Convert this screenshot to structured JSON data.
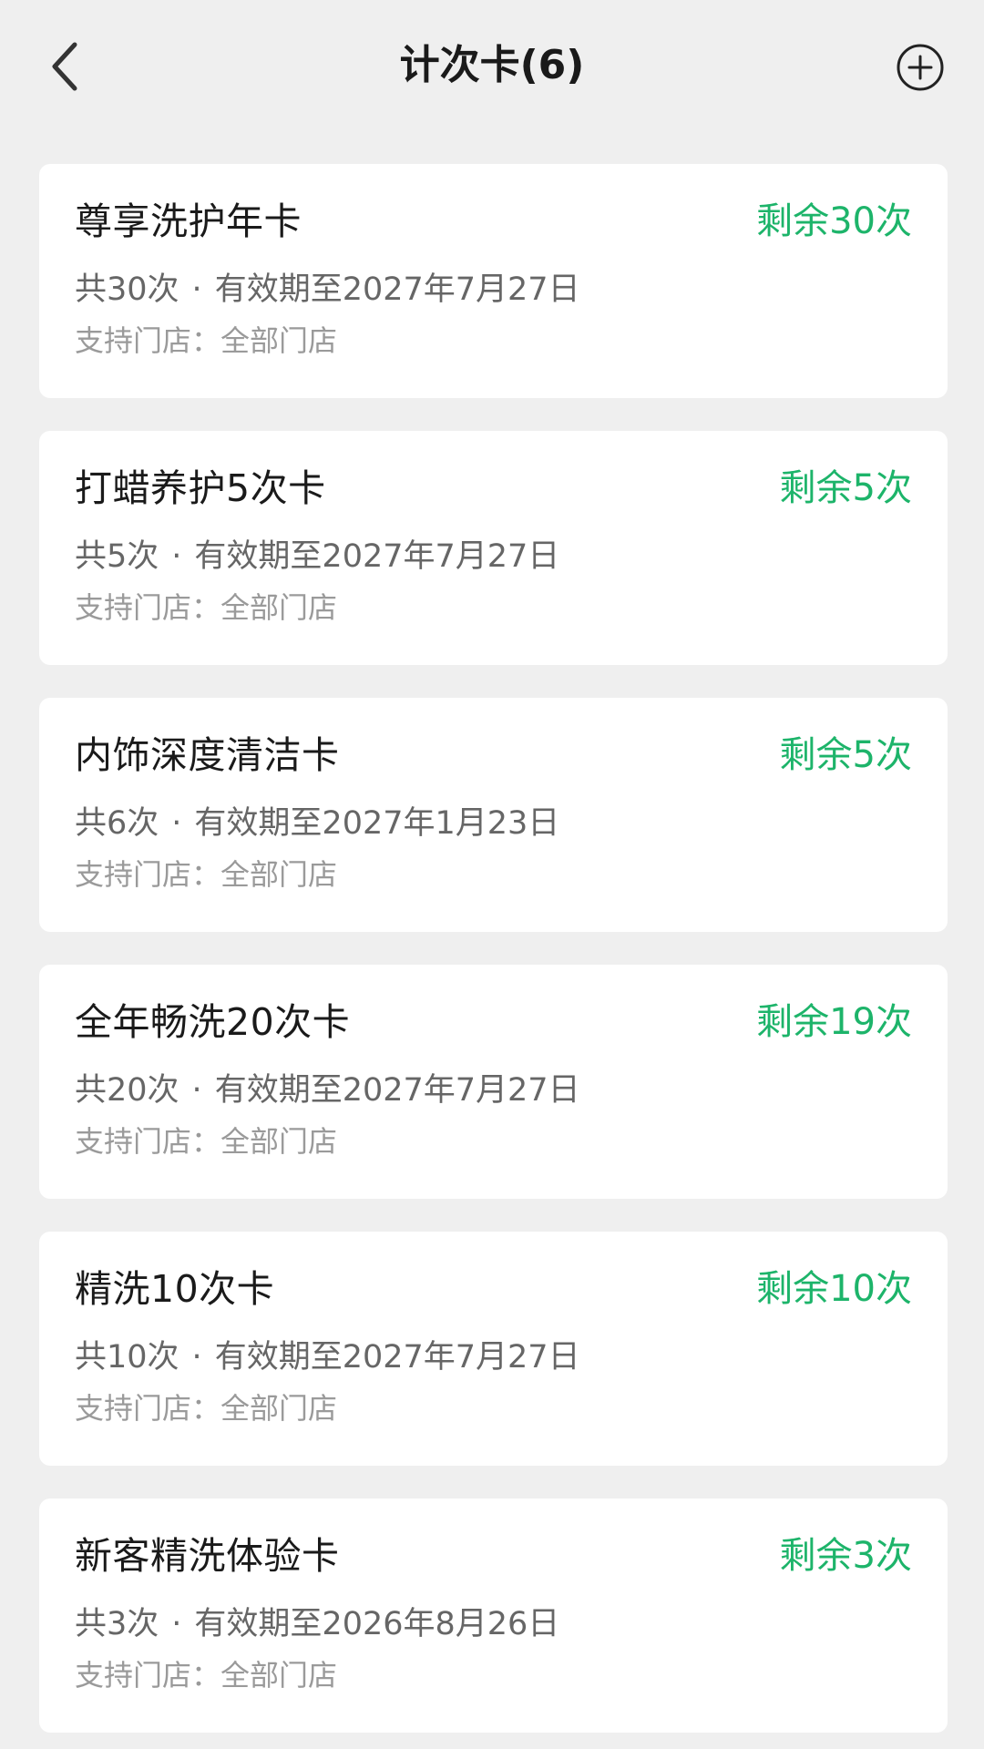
{
  "header": {
    "title": "计次卡(6)",
    "back_icon": "chevron-left-icon",
    "add_icon": "plus-circle-icon"
  },
  "colors": {
    "accent": "#1db46a",
    "background": "#efefef",
    "card": "#ffffff"
  },
  "cards": [
    {
      "name": "尊享洗护年卡",
      "remaining": "剩余30次",
      "total": "共30次",
      "separator": "·",
      "validity": "有效期至2027年7月27日",
      "stores_label": "支持门店：",
      "stores_value": "全部门店"
    },
    {
      "name": "打蜡养护5次卡",
      "remaining": "剩余5次",
      "total": "共5次",
      "separator": "·",
      "validity": "有效期至2027年7月27日",
      "stores_label": "支持门店：",
      "stores_value": "全部门店"
    },
    {
      "name": "内饰深度清洁卡",
      "remaining": "剩余5次",
      "total": "共6次",
      "separator": "·",
      "validity": "有效期至2027年1月23日",
      "stores_label": "支持门店：",
      "stores_value": "全部门店"
    },
    {
      "name": "全年畅洗20次卡",
      "remaining": "剩余19次",
      "total": "共20次",
      "separator": "·",
      "validity": "有效期至2027年7月27日",
      "stores_label": "支持门店：",
      "stores_value": "全部门店"
    },
    {
      "name": "精洗10次卡",
      "remaining": "剩余10次",
      "total": "共10次",
      "separator": "·",
      "validity": "有效期至2027年7月27日",
      "stores_label": "支持门店：",
      "stores_value": "全部门店"
    },
    {
      "name": "新客精洗体验卡",
      "remaining": "剩余3次",
      "total": "共3次",
      "separator": "·",
      "validity": "有效期至2026年8月26日",
      "stores_label": "支持门店：",
      "stores_value": "全部门店"
    }
  ]
}
